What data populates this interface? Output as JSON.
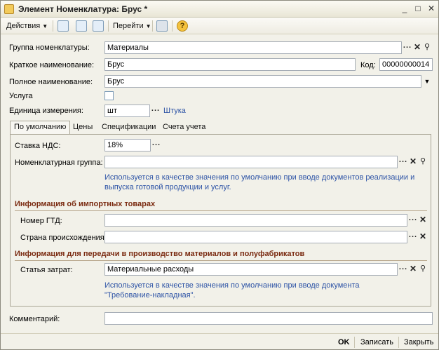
{
  "window": {
    "title": "Элемент Номенклатура: Брус *",
    "minimize": "_",
    "maximize": "□",
    "close": "✕"
  },
  "toolbar": {
    "actions_label": "Действия",
    "goto_label": "Перейти",
    "help_glyph": "?"
  },
  "form": {
    "group_label": "Группа номенклатуры:",
    "group_value": "Материалы",
    "short_name_label": "Краткое наименование:",
    "short_name_value": "Брус",
    "code_label": "Код:",
    "code_value": "00000000014",
    "full_name_label": "Полное наименование:",
    "full_name_value": "Брус",
    "service_label": "Услуга",
    "unit_label": "Единица измерения:",
    "unit_value": "шт",
    "unit_link": "Штука"
  },
  "tabs": [
    {
      "label": "По умолчанию",
      "active": true
    },
    {
      "label": "Цены"
    },
    {
      "label": "Спецификации"
    },
    {
      "label": "Счета учета"
    }
  ],
  "default_tab": {
    "vat_label": "Ставка НДС:",
    "vat_value": "18%",
    "nomen_group_label": "Номенклатурная группа:",
    "nomen_group_value": "",
    "nomen_group_hint_line1": "Используется в качестве значения по умолчанию при вводе документов  реализации и",
    "nomen_group_hint_line2": "выпуска готовой продукции и услуг.",
    "import_section": "Информация об импортных товарах",
    "gtd_label": "Номер ГТД:",
    "gtd_value": "",
    "country_label": "Страна происхождения:",
    "country_value": "",
    "production_section": "Информация для передачи в производство материалов и полуфабрикатов",
    "cost_label": "Статья затрат:",
    "cost_value": "Материальные расходы",
    "cost_hint_line1": "Используется в качестве значения по умолчанию при вводе документа",
    "cost_hint_line2": "\"Требование-накладная\"."
  },
  "comment": {
    "label": "Комментарий:",
    "value": ""
  },
  "bottom": {
    "ok": "OK",
    "save": "Записать",
    "close": "Закрыть"
  },
  "colors": {
    "link": "#2e54a6",
    "section_title": "#7a2a10",
    "window_bg": "#f2f1e9"
  }
}
